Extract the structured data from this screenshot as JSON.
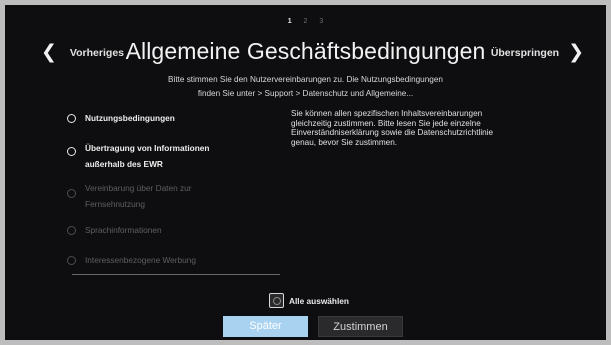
{
  "pager": {
    "pages": [
      "1",
      "2",
      "3"
    ],
    "active": "1"
  },
  "nav": {
    "prev_label": "Vorheriges",
    "next_label": "Überspringen",
    "prev_icon": "chevron-left-icon",
    "next_icon": "chevron-right-icon"
  },
  "title": "Allgemeine Geschäftsbedingungen",
  "subtitle": {
    "line1": "Bitte stimmen Sie den Nutzervereinbarungen zu. Die Nutzungsbedingungen",
    "line2": "finden Sie unter > Support > Datenschutz und Allgemeine..."
  },
  "agreements": [
    {
      "line1": "Nutzungsbedingungen",
      "line2": "",
      "enabled": true
    },
    {
      "line1": "Übertragung von Informationen",
      "line2": "außerhalb des EWR",
      "enabled": true
    },
    {
      "line1": "Vereinbarung über Daten zur",
      "line2": "Fernsehnutzung",
      "enabled": false
    },
    {
      "line1": "Sprachinformationen",
      "line2": "",
      "enabled": false
    },
    {
      "line1": "Interessenbezogene Werbung",
      "line2": "",
      "enabled": false
    }
  ],
  "info": {
    "line1": "Sie können allen spezifischen Inhaltsvereinbarungen",
    "line2": "gleichzeitig zustimmen. Bitte lesen Sie jede einzelne",
    "line3": "Einverständniserklärung sowie die Datenschutzrichtlinie",
    "line4": "genau, bevor Sie zustimmen."
  },
  "select_all": {
    "label": "Alle auswählen",
    "checked": false
  },
  "buttons": {
    "later": "Später",
    "agree": "Zustimmen"
  },
  "colors": {
    "background": "#0e0e10",
    "later_button": "#a8d2f0",
    "agree_button": "#2a2a2c",
    "disabled_text": "#5f5f5f"
  }
}
